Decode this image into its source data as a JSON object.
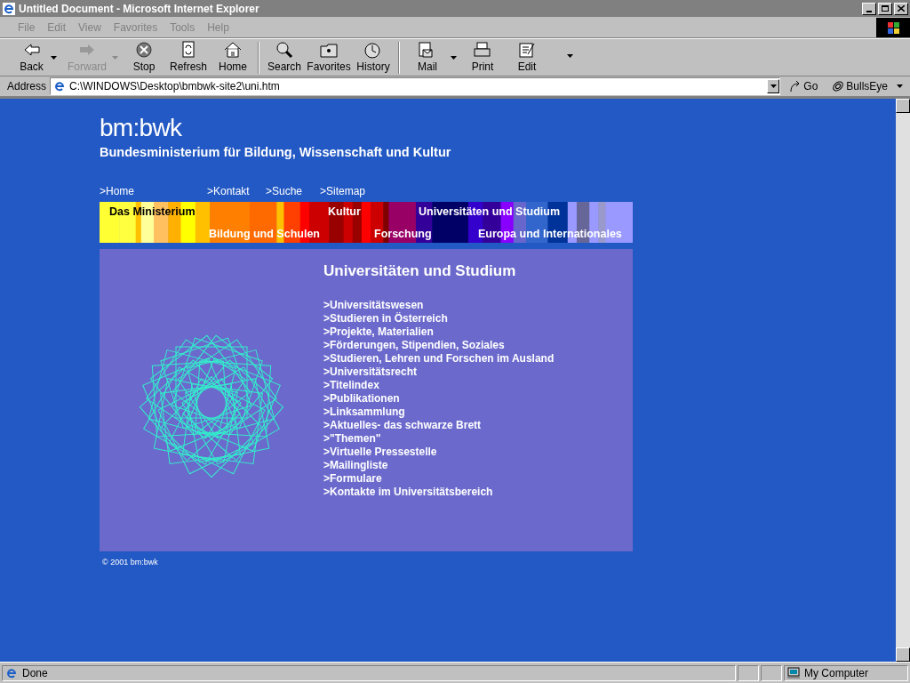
{
  "window": {
    "title": "Untitled Document - Microsoft Internet Explorer"
  },
  "menu": [
    "File",
    "Edit",
    "View",
    "Favorites",
    "Tools",
    "Help"
  ],
  "toolbar": [
    {
      "label": "Back",
      "kind": "back",
      "disabled": false,
      "dropdown": true
    },
    {
      "label": "Forward",
      "kind": "forward",
      "disabled": true,
      "dropdown": true
    },
    {
      "label": "Stop",
      "kind": "stop",
      "disabled": false,
      "dropdown": false
    },
    {
      "label": "Refresh",
      "kind": "refresh",
      "disabled": false,
      "dropdown": false
    },
    {
      "label": "Home",
      "kind": "home",
      "disabled": false,
      "dropdown": false
    },
    {
      "label": "Search",
      "kind": "search",
      "disabled": false,
      "dropdown": false
    },
    {
      "label": "Favorites",
      "kind": "favorites",
      "disabled": false,
      "dropdown": false
    },
    {
      "label": "History",
      "kind": "history",
      "disabled": false,
      "dropdown": false
    },
    {
      "label": "Mail",
      "kind": "mail",
      "disabled": false,
      "dropdown": true
    },
    {
      "label": "Print",
      "kind": "print",
      "disabled": false,
      "dropdown": false
    },
    {
      "label": "Edit",
      "kind": "edit",
      "disabled": false,
      "dropdown": false
    }
  ],
  "address_bar": {
    "label": "Address",
    "value": "C:\\WINDOWS\\Desktop\\bmbwk-site2\\uni.htm",
    "go": "Go",
    "links": "BullsEye"
  },
  "page": {
    "logo": "bm:bwk",
    "subtitle": "Bundesministerium für Bildung, Wissenschaft und Kultur",
    "top_links": [
      ">Home",
      ">Kontakt",
      ">Suche",
      ">Sitemap"
    ],
    "categories": [
      {
        "label": "Das Ministerium",
        "kind": "top"
      },
      {
        "label": "Bildung und Schulen",
        "kind": "bottom"
      },
      {
        "label": "Kultur",
        "kind": "top"
      },
      {
        "label": "Forschung",
        "kind": "bottom"
      },
      {
        "label": "Universitäten und Studium",
        "kind": "top"
      },
      {
        "label": "Europa und Internationales",
        "kind": "bottom"
      }
    ],
    "heading": "Universitäten und Studium",
    "links": [
      ">Universitätswesen",
      ">Studieren in Österreich",
      ">Projekte, Materialien",
      ">Förderungen, Stipendien, Soziales",
      ">Studieren, Lehren und Forschen im Ausland",
      ">Universitätsrecht",
      ">Titelindex",
      ">Publikationen",
      ">Linksammlung",
      ">Aktuelles- das schwarze Brett",
      ">\"Themen\"",
      ">Virtuelle Pressestelle",
      ">Mailingliste",
      ">Formulare",
      ">Kontakte im Universitätsbereich"
    ],
    "copyright": "© 2001 bm:bwk"
  },
  "status_bar": {
    "text": "Done",
    "zone": "My Computer"
  }
}
